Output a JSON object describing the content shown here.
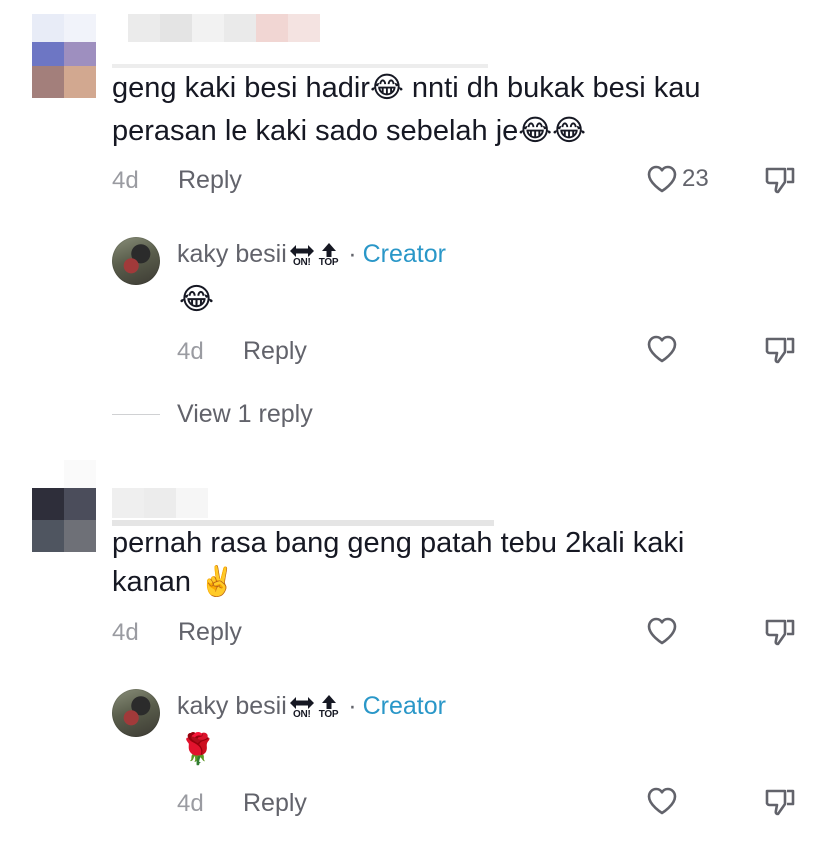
{
  "comments": [
    {
      "text_line1": "geng kaki besi hadir😂 nnti dh bukak besi kau",
      "text_line2": "perasan le kaki sado sebelah je😂😂",
      "time": "4d",
      "reply_label": "Reply",
      "like_count": "23",
      "reply": {
        "author": "kaky besii",
        "badge_on": "ON!",
        "badge_top": "TOP",
        "separator": "·",
        "role": "Creator",
        "text": "😂",
        "time": "4d",
        "reply_label": "Reply"
      },
      "view_replies": "View 1 reply"
    },
    {
      "text_line1": "pernah rasa bang geng patah tebu 2kali kaki",
      "text_line2": "kanan ✌️",
      "time": "4d",
      "reply_label": "Reply",
      "reply": {
        "author": "kaky besii",
        "badge_on": "ON!",
        "badge_top": "TOP",
        "separator": "·",
        "role": "Creator",
        "text": "🌹",
        "time": "4d",
        "reply_label": "Reply"
      }
    }
  ],
  "icons": {
    "like": "heart-outline-icon",
    "dislike": "thumbs-down-icon",
    "swap": "left-right-arrow-icon",
    "up": "up-arrow-icon"
  },
  "colors": {
    "text": "#161823",
    "muted": "#62636b",
    "time": "#9a9ba1",
    "creator": "#2a97c8"
  }
}
